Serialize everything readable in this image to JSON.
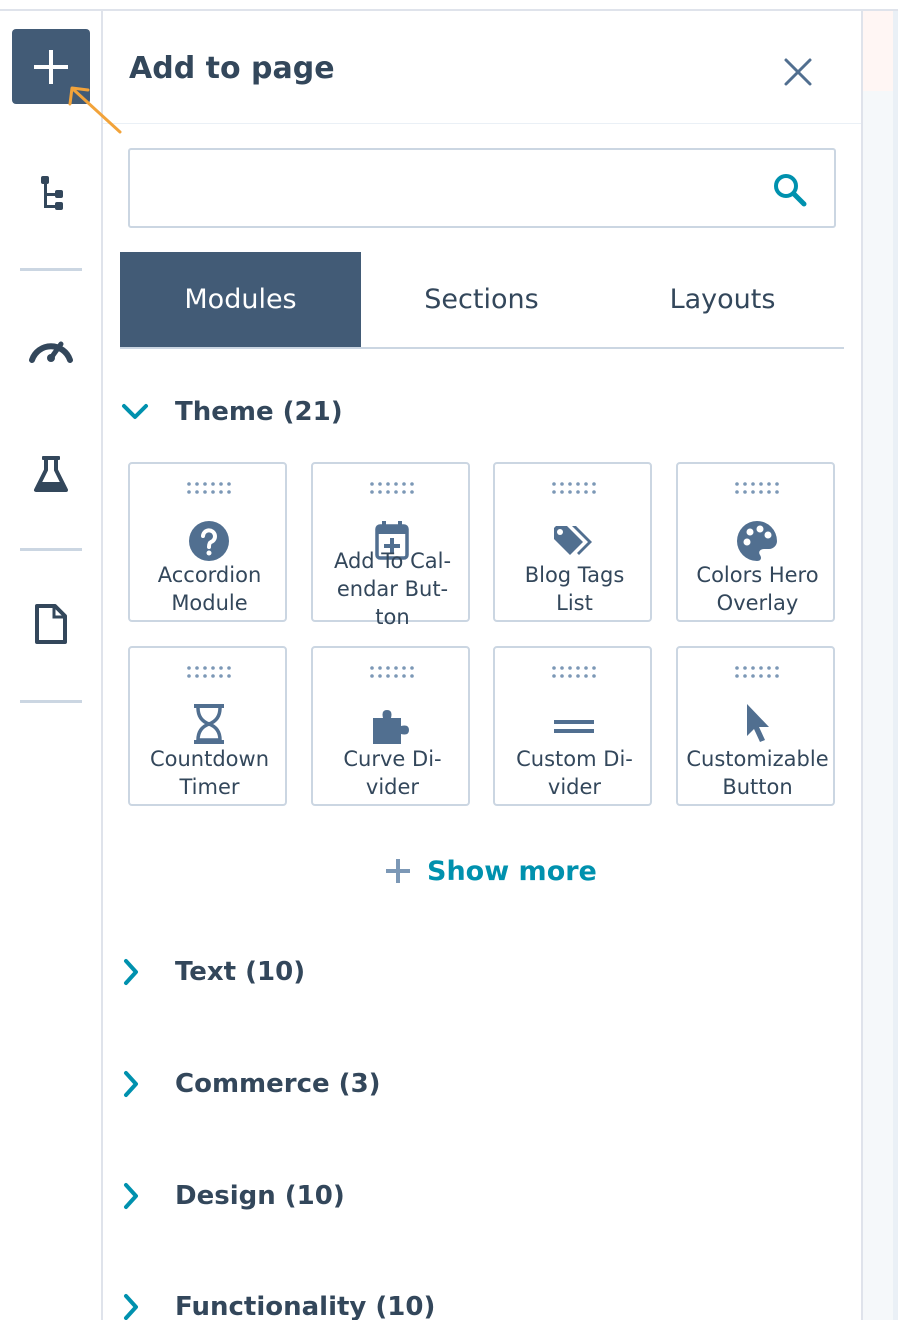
{
  "panel": {
    "title": "Add to page",
    "search": {
      "placeholder": "",
      "value": ""
    }
  },
  "tabs": [
    {
      "label": "Modules",
      "active": true
    },
    {
      "label": "Sections",
      "active": false
    },
    {
      "label": "Layouts",
      "active": false
    }
  ],
  "groups": {
    "theme": {
      "label": "Theme (21)",
      "expanded": true
    },
    "text": {
      "label": "Text (10)",
      "expanded": false
    },
    "commerce": {
      "label": "Commerce (3)",
      "expanded": false
    },
    "design": {
      "label": "Design (10)",
      "expanded": false
    },
    "functionality": {
      "label": "Functionality (10)",
      "expanded": false
    }
  },
  "modules": [
    {
      "label": "Accordion\nModule",
      "icon": "question-circle-icon"
    },
    {
      "label": "Add To Cal-\nendar But-\nton",
      "icon": "calendar-add-icon"
    },
    {
      "label": "Blog Tags\nList",
      "icon": "tags-icon"
    },
    {
      "label": "Colors Hero\nOverlay",
      "icon": "palette-icon"
    },
    {
      "label": "Countdown\nTimer",
      "icon": "hourglass-icon"
    },
    {
      "label": "Curve Di-\nvider",
      "icon": "puzzle-icon"
    },
    {
      "label": "Custom Di-\nvider",
      "icon": "divider-lines-icon"
    },
    {
      "label": "Customizable\nButton",
      "icon": "pointer-icon"
    }
  ],
  "show_more": {
    "label": "Show more"
  },
  "colors": {
    "primary_dark": "#425b76",
    "text": "#33475b",
    "accent_teal": "#0091ae",
    "border": "#cbd6e2",
    "icon_fill": "#516f90",
    "cursor_orange": "#f2a33a"
  }
}
